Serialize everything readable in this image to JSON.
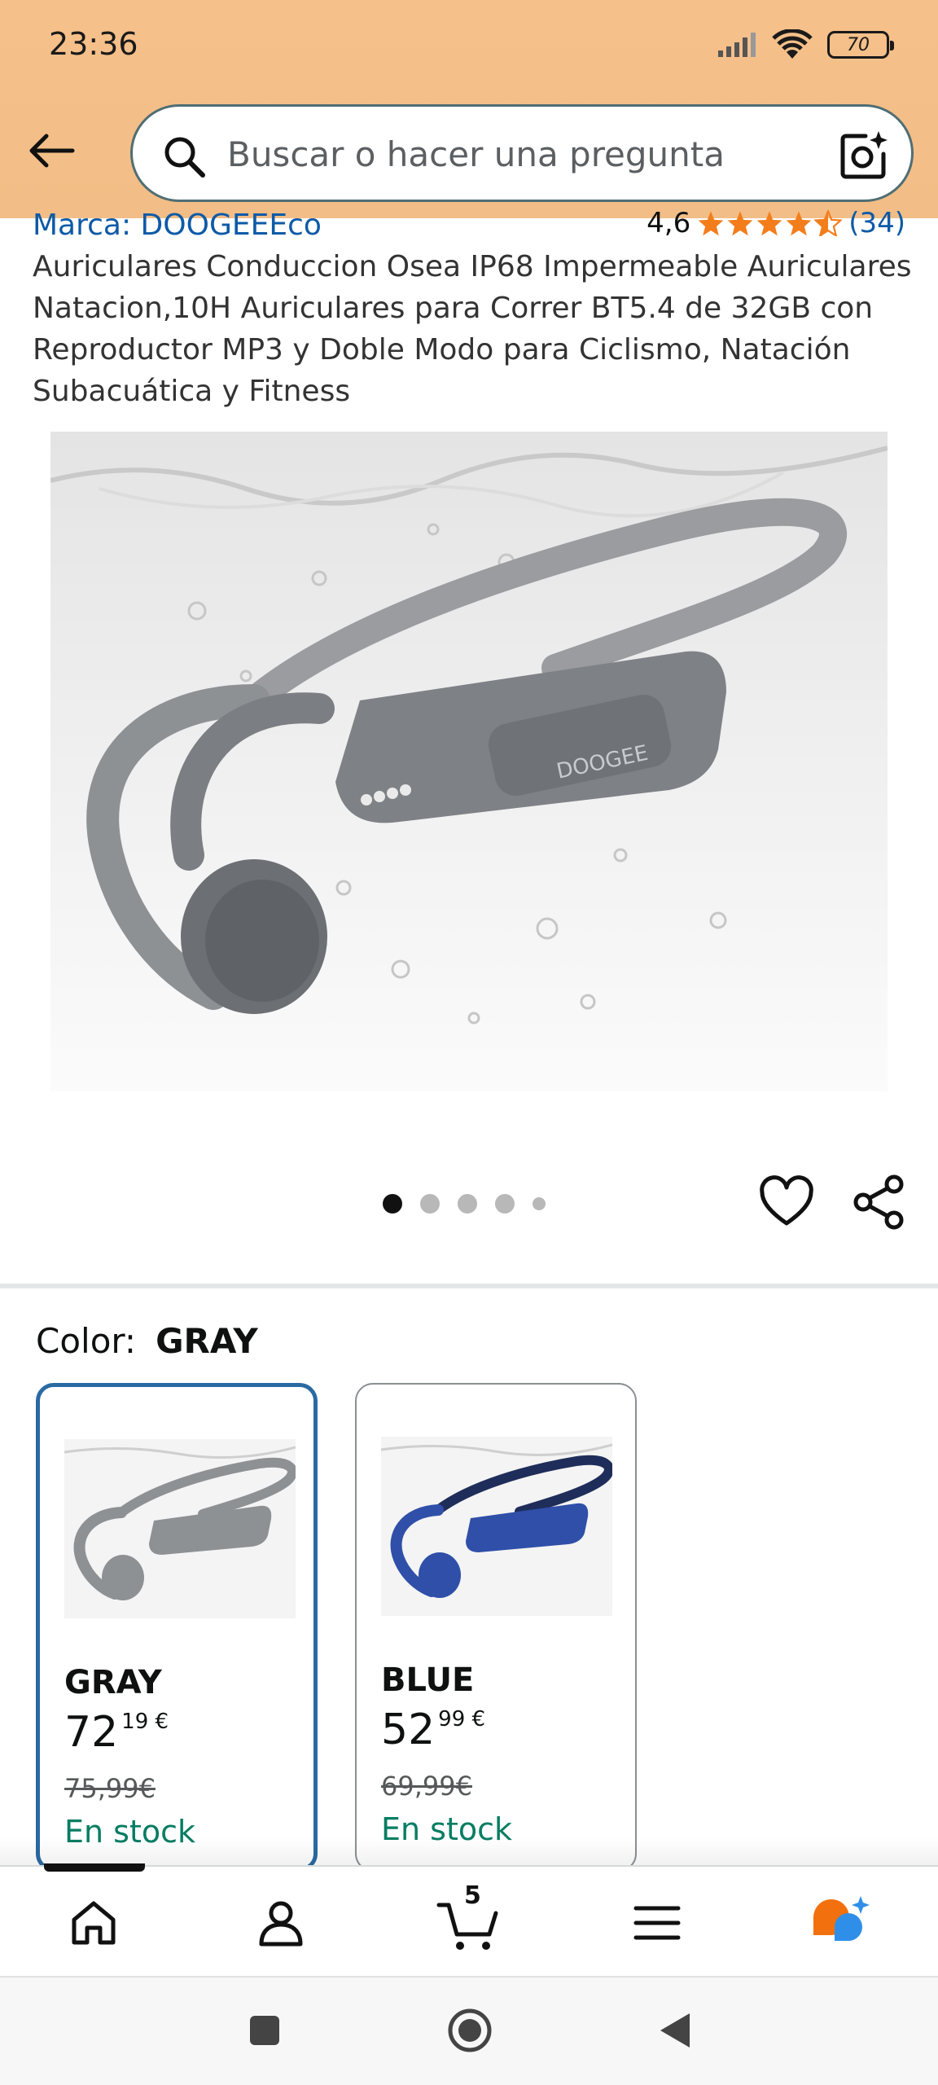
{
  "status_bar": {
    "time": "23:36",
    "battery": "70"
  },
  "search": {
    "placeholder": "Buscar o hacer una pregunta"
  },
  "product": {
    "brand": "Marca: DOOGEEEco",
    "rating_value": "4,6",
    "rating_stars": 4.5,
    "rating_count": "(34)",
    "title": "Auriculares Conduccion Osea IP68 Impermeable Auriculares Natacion,10H Auriculares para Correr BT5.4 de 32GB con Reproductor MP3 y Doble Modo para Ciclismo, Natación Subacuática y Fitness",
    "image_brand_text": "DOOGEE"
  },
  "carousel": {
    "count": 5,
    "active_index": 0
  },
  "color_section": {
    "label": "Color:",
    "selected": "GRAY",
    "options": [
      {
        "name": "GRAY",
        "price_whole": "72",
        "price_fraction": "19",
        "currency": "€",
        "old_price": "75,99€",
        "stock": "En stock",
        "color": "#8e9194"
      },
      {
        "name": "BLUE",
        "price_whole": "52",
        "price_fraction": "99",
        "currency": "€",
        "old_price": "69,99€",
        "stock": "En stock",
        "color": "#2f4fa8"
      }
    ]
  },
  "bottom_nav": {
    "cart_count": "5",
    "items": [
      "home-icon",
      "account-icon",
      "cart-icon",
      "menu-icon",
      "rufus-icon"
    ]
  },
  "colors": {
    "header_bg": "#f6c08a",
    "link": "#0d5aa7",
    "stock": "#067d62",
    "star": "#f47d1b",
    "selected_border": "#2a6aa3"
  }
}
